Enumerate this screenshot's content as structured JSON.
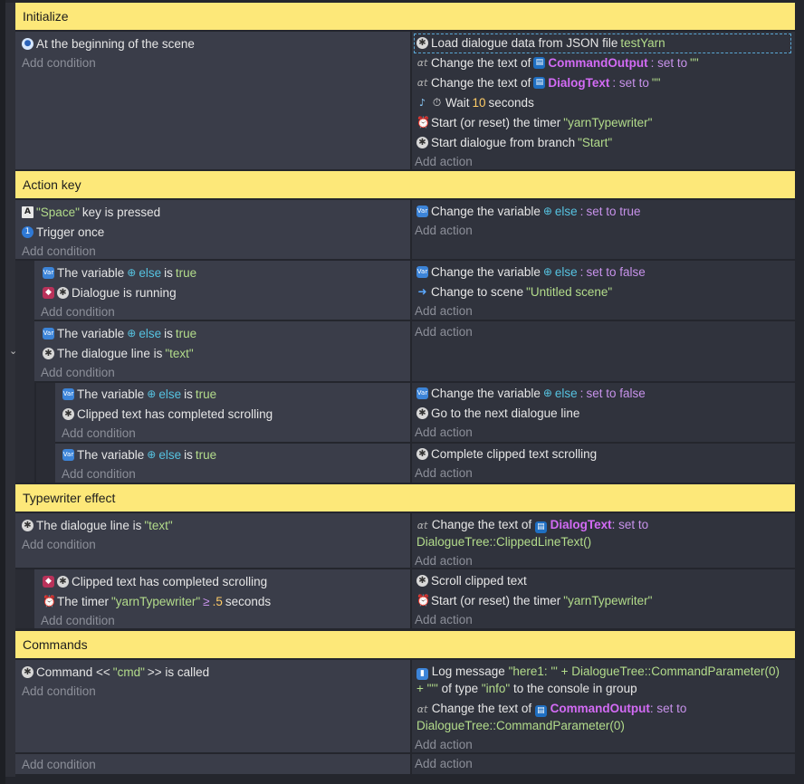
{
  "groups": {
    "initialize": "Initialize",
    "action_key": "Action key",
    "typewriter": "Typewriter effect",
    "commands": "Commands"
  },
  "common": {
    "add_condition": "Add condition",
    "add_action": "Add action"
  },
  "ev1": {
    "cond1": "At the beginning of the scene",
    "a1_text": "Load dialogue data from JSON file",
    "a1_file": "testYarn",
    "a2_pre": "Change the text of",
    "a2_obj": "CommandOutput",
    "a2_mid": ": set to",
    "a2_val": "\"\"",
    "a3_pre": "Change the text of",
    "a3_obj": "DialogText",
    "a3_mid": ": set to",
    "a3_val": "\"\"",
    "a4_pre": "Wait",
    "a4_num": "10",
    "a4_post": "seconds",
    "a5_pre": "Start (or reset) the timer",
    "a5_val": "\"yarnTypewriter\"",
    "a6_pre": "Start dialogue from branch",
    "a6_val": "\"Start\""
  },
  "ev2": {
    "c1_val": "\"Space\"",
    "c1_post": "key is pressed",
    "c2": "Trigger once",
    "a1_pre": "Change the variable",
    "a1_var": "else",
    "a1_post": ":",
    "a1_set": "set to true"
  },
  "ev3": {
    "c1_pre": "The variable",
    "c1_var": "else",
    "c1_is": "is",
    "c1_val": "true",
    "c2": "Dialogue is running",
    "a1_pre": "Change the variable",
    "a1_var": "else",
    "a1_post": ":",
    "a1_set": "set to false",
    "a2_pre": "Change to scene",
    "a2_val": "\"Untitled scene\""
  },
  "ev4": {
    "c1_pre": "The variable",
    "c1_var": "else",
    "c1_is": "is",
    "c1_val": "true",
    "c2_pre": "The dialogue line is",
    "c2_val": "\"text\""
  },
  "ev5": {
    "c1_pre": "The variable",
    "c1_var": "else",
    "c1_is": "is",
    "c1_val": "true",
    "c2": "Clipped text has completed scrolling",
    "a1_pre": "Change the variable",
    "a1_var": "else",
    "a1_post": ":",
    "a1_set": "set to false",
    "a2": "Go to the next dialogue line"
  },
  "ev6": {
    "c1_pre": "The variable",
    "c1_var": "else",
    "c1_is": "is",
    "c1_val": "true",
    "a1": "Complete clipped text scrolling"
  },
  "ev7": {
    "c1_pre": "The dialogue line is",
    "c1_val": "\"text\"",
    "a1_pre": "Change the text of",
    "a1_obj": "DialogText",
    "a1_mid": ": set to",
    "a1_val": "DialogueTree::ClippedLineText()"
  },
  "ev8": {
    "c1": "Clipped text has completed scrolling",
    "c2_pre": "The timer",
    "c2_val": "\"yarnTypewriter\"",
    "c2_op": "≥",
    "c2_num": ".5",
    "c2_post": "seconds",
    "a1": "Scroll clipped text",
    "a2_pre": "Start (or reset) the timer",
    "a2_val": "\"yarnTypewriter\""
  },
  "ev9": {
    "c1_pre": "Command <<",
    "c1_val": "\"cmd\"",
    "c1_post": ">> is called",
    "a1_pre": "Log message",
    "a1_val1": "\"here1: '\"",
    "a1_mid": "+ DialogueTree::CommandParameter(0)",
    "a1_val2": "+ \"'\"",
    "a1_of": "of type",
    "a1_type": "\"info\"",
    "a1_post": "to the console in group",
    "a2_pre": "Change the text of",
    "a2_obj": "CommandOutput",
    "a2_mid": ": set to",
    "a2_val": "DialogueTree::CommandParameter(0)"
  },
  "colors": {
    "group_header": "#fde879",
    "condition_panel": "#3a3d49",
    "action_panel": "#30333d",
    "string": "#b3dc8b",
    "number": "#ffcc66",
    "keyword": "#c792ea",
    "object": "#d36bf5",
    "variable": "#56c2e0"
  }
}
